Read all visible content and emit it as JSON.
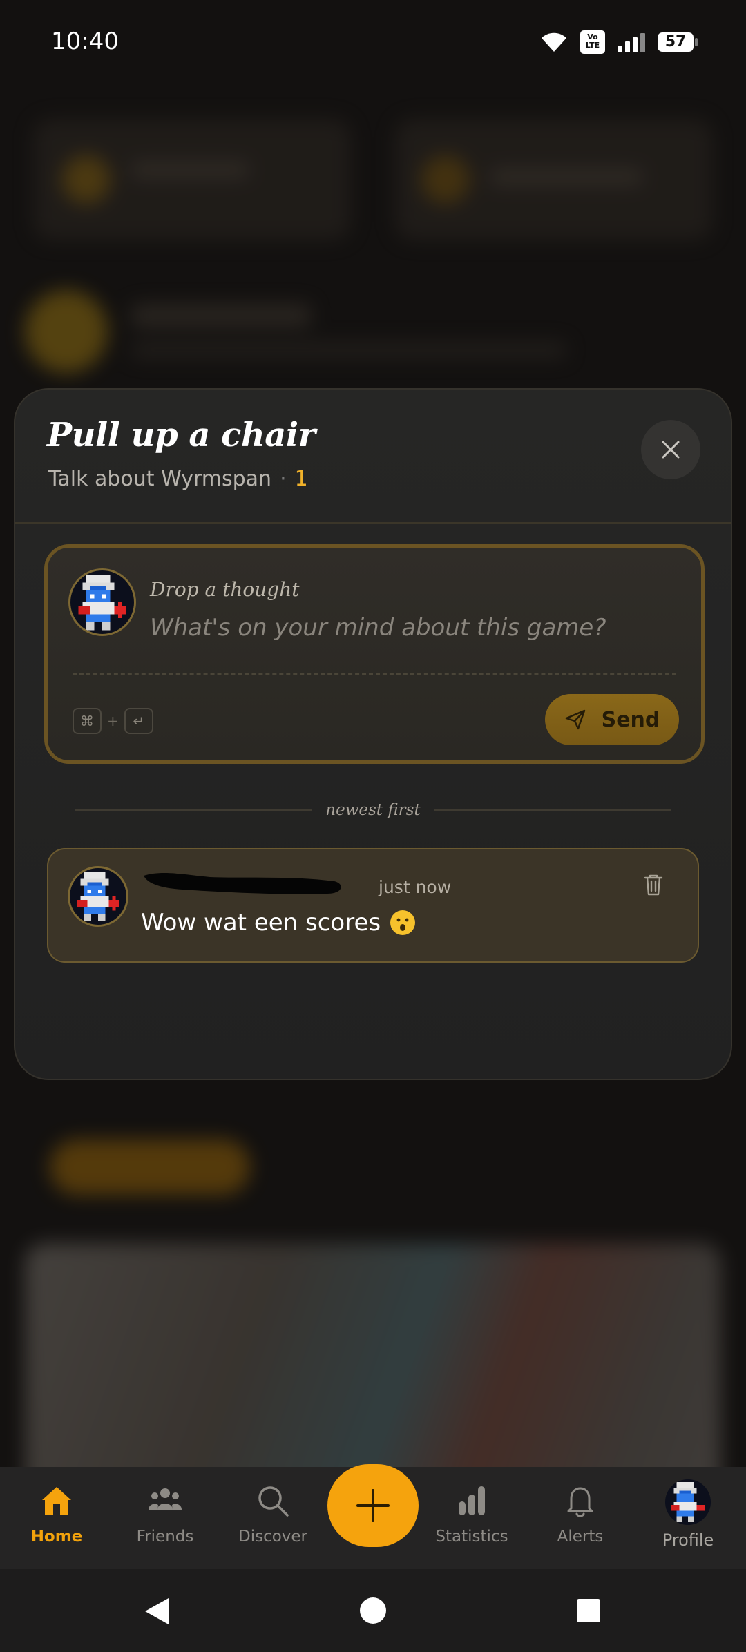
{
  "status_bar": {
    "time": "10:40",
    "network_badge": "Vo\nLTE",
    "battery": "57"
  },
  "sheet": {
    "title": "Pull up a chair",
    "subtitle": "Talk about Wyrmspan",
    "separator": "·",
    "comment_count": "1",
    "close_icon": "close-icon"
  },
  "composer": {
    "label": "Drop a thought",
    "placeholder": "What's on your mind about this game?",
    "value": "",
    "shortcut_key1": "⌘",
    "shortcut_plus": "+",
    "shortcut_key2": "↵",
    "send_label": "Send"
  },
  "comments": {
    "order_label": "newest first",
    "items": [
      {
        "time": "just now",
        "text": "Wow wat een scores",
        "emoji": "astonished-face"
      }
    ]
  },
  "bottom_nav": {
    "items": [
      {
        "label": "Home",
        "icon": "home-icon",
        "active": true
      },
      {
        "label": "Friends",
        "icon": "friends-icon"
      },
      {
        "label": "Discover",
        "icon": "search-icon"
      },
      {
        "label": "Statistics",
        "icon": "bar-chart-icon"
      },
      {
        "label": "Alerts",
        "icon": "bell-icon"
      },
      {
        "label": "Profile",
        "icon": "avatar"
      }
    ],
    "fab_icon": "plus-icon"
  },
  "colors": {
    "accent": "#f5a30d",
    "background": "#131110",
    "sheet": "#232322",
    "comment_card": "#3b3427"
  }
}
